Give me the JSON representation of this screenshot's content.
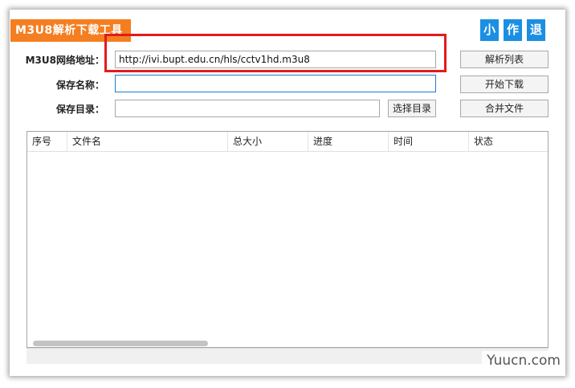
{
  "app": {
    "title": "M3U8解析下载工具"
  },
  "window_buttons": {
    "minimize": "小",
    "author": "作",
    "exit": "退"
  },
  "form": {
    "url_label": "M3U8网络地址：",
    "url_value": "http://ivi.bupt.edu.cn/hls/cctv1hd.m3u8",
    "name_label": "保存名称：",
    "name_value": "",
    "dir_label": "保存目录：",
    "dir_value": ""
  },
  "buttons": {
    "parse_list": "解析列表",
    "start_download": "开始下载",
    "merge_files": "合并文件",
    "choose_dir": "选择目录"
  },
  "table": {
    "columns": [
      "序号",
      "文件名",
      "总大小",
      "进度",
      "时间",
      "状态"
    ],
    "rows": []
  },
  "watermark": "Yuucn.com"
}
